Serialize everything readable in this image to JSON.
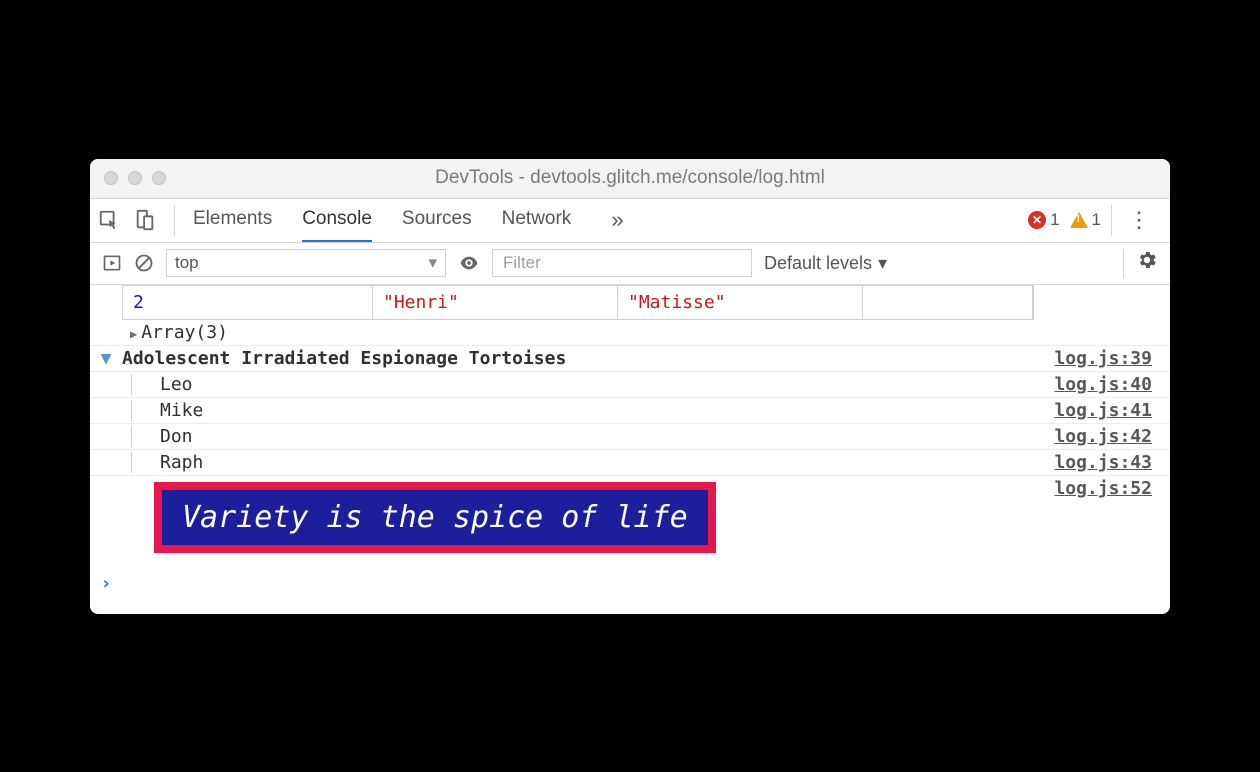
{
  "window": {
    "title": "DevTools - devtools.glitch.me/console/log.html"
  },
  "tabs": {
    "elements": "Elements",
    "console": "Console",
    "sources": "Sources",
    "network": "Network"
  },
  "badges": {
    "errors": "1",
    "warnings": "1"
  },
  "toolbar": {
    "context": "top",
    "filter_placeholder": "Filter",
    "levels": "Default levels"
  },
  "table": {
    "index": "2",
    "first": "\"Henri\"",
    "last": "\"Matisse\""
  },
  "array": {
    "label": "Array(3)"
  },
  "group": {
    "title": "Adolescent Irradiated Espionage Tortoises",
    "src": "log.js:39",
    "items": [
      {
        "name": "Leo",
        "src": "log.js:40"
      },
      {
        "name": "Mike",
        "src": "log.js:41"
      },
      {
        "name": "Don",
        "src": "log.js:42"
      },
      {
        "name": "Raph",
        "src": "log.js:43"
      }
    ]
  },
  "styled": {
    "text": "Variety is the spice of life",
    "src": "log.js:52"
  }
}
